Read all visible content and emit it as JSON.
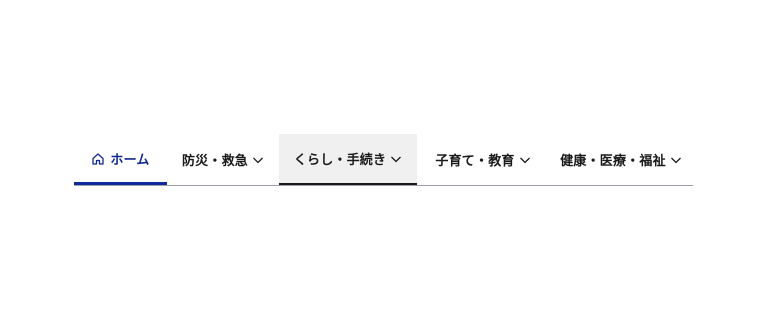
{
  "nav": {
    "items": [
      {
        "label": "ホーム",
        "icon": "home-icon",
        "active": true,
        "dropdown": false
      },
      {
        "label": "防災・救急",
        "icon": "chevron-down-icon",
        "active": false,
        "dropdown": true
      },
      {
        "label": "くらし・手続き",
        "icon": "chevron-down-icon",
        "active": false,
        "dropdown": true,
        "hovered": true
      },
      {
        "label": "子育て・教育",
        "icon": "chevron-down-icon",
        "active": false,
        "dropdown": true
      },
      {
        "label": "健康・医療・福祉",
        "icon": "chevron-down-icon",
        "active": false,
        "dropdown": true
      }
    ]
  },
  "colors": {
    "active_text": "#10288f",
    "active_underline": "#0f2a9c",
    "hover_background": "#f0f0f0",
    "text": "#1a1a1a",
    "divider": "#9aa0a6"
  }
}
